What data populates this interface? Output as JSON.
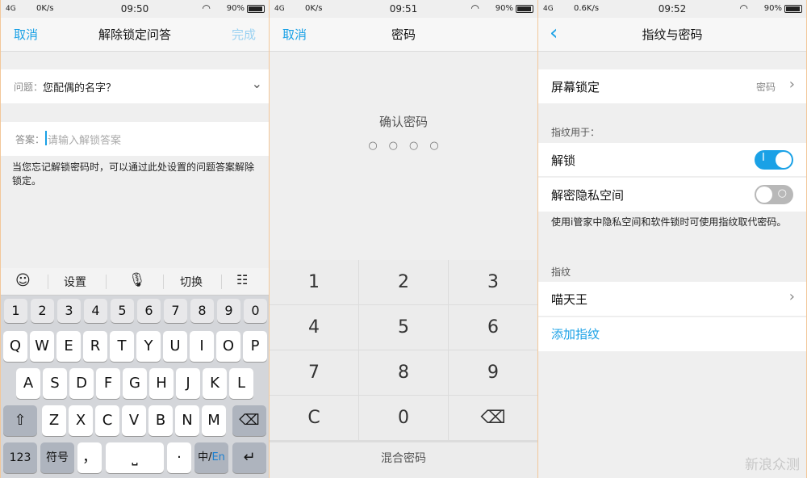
{
  "screen1": {
    "status": {
      "signal": "4G",
      "net": "0K/s",
      "time": "09:50",
      "battery": "90%"
    },
    "title": "解除锁定问答",
    "cancel": "取消",
    "done": "完成",
    "question_label": "问题：",
    "question_value": "您配偶的名字？",
    "answer_label": "答案：",
    "answer_placeholder": "请输入解锁答案",
    "hint": "当您忘记解锁密码时，可以通过此处设置的问题答案解除锁定。",
    "keyboard": {
      "bar": [
        "设置",
        "切换"
      ],
      "numbers": [
        "1",
        "2",
        "3",
        "4",
        "5",
        "6",
        "7",
        "8",
        "9",
        "0"
      ],
      "row1": [
        "Q",
        "W",
        "E",
        "R",
        "T",
        "Y",
        "U",
        "I",
        "O",
        "P"
      ],
      "row2": [
        "A",
        "S",
        "D",
        "F",
        "G",
        "H",
        "J",
        "K",
        "L"
      ],
      "row3": [
        "Z",
        "X",
        "C",
        "V",
        "B",
        "N",
        "M"
      ],
      "k123": "123",
      "symbol": "符号",
      "comma": "，",
      "dot": "·",
      "lang_a": "中/",
      "lang_b": "En"
    }
  },
  "screen2": {
    "status": {
      "signal": "4G",
      "net": "0K/s",
      "time": "09:51",
      "battery": "90%"
    },
    "title": "密码",
    "cancel": "取消",
    "confirm": "确认密码",
    "pad": [
      "1",
      "2",
      "3",
      "4",
      "5",
      "6",
      "7",
      "8",
      "9",
      "C",
      "0"
    ],
    "mixed": "混合密码"
  },
  "screen3": {
    "status": {
      "signal": "4G",
      "net": "0.6K/s",
      "time": "09:52",
      "battery": "90%"
    },
    "title": "指纹与密码",
    "screen_lock": "屏幕锁定",
    "screen_lock_value": "密码",
    "fp_for": "指纹用于：",
    "unlock": "解锁",
    "unlock_on": true,
    "private": "解密隐私空间",
    "private_on": false,
    "desc": "使用i管家中隐私空间和软件锁时可使用指纹取代密码。",
    "fp_section": "指纹",
    "fp_name": "喵天王",
    "add_fp": "添加指纹",
    "accent": "#1aa1e6"
  },
  "watermark": "新浪众测"
}
